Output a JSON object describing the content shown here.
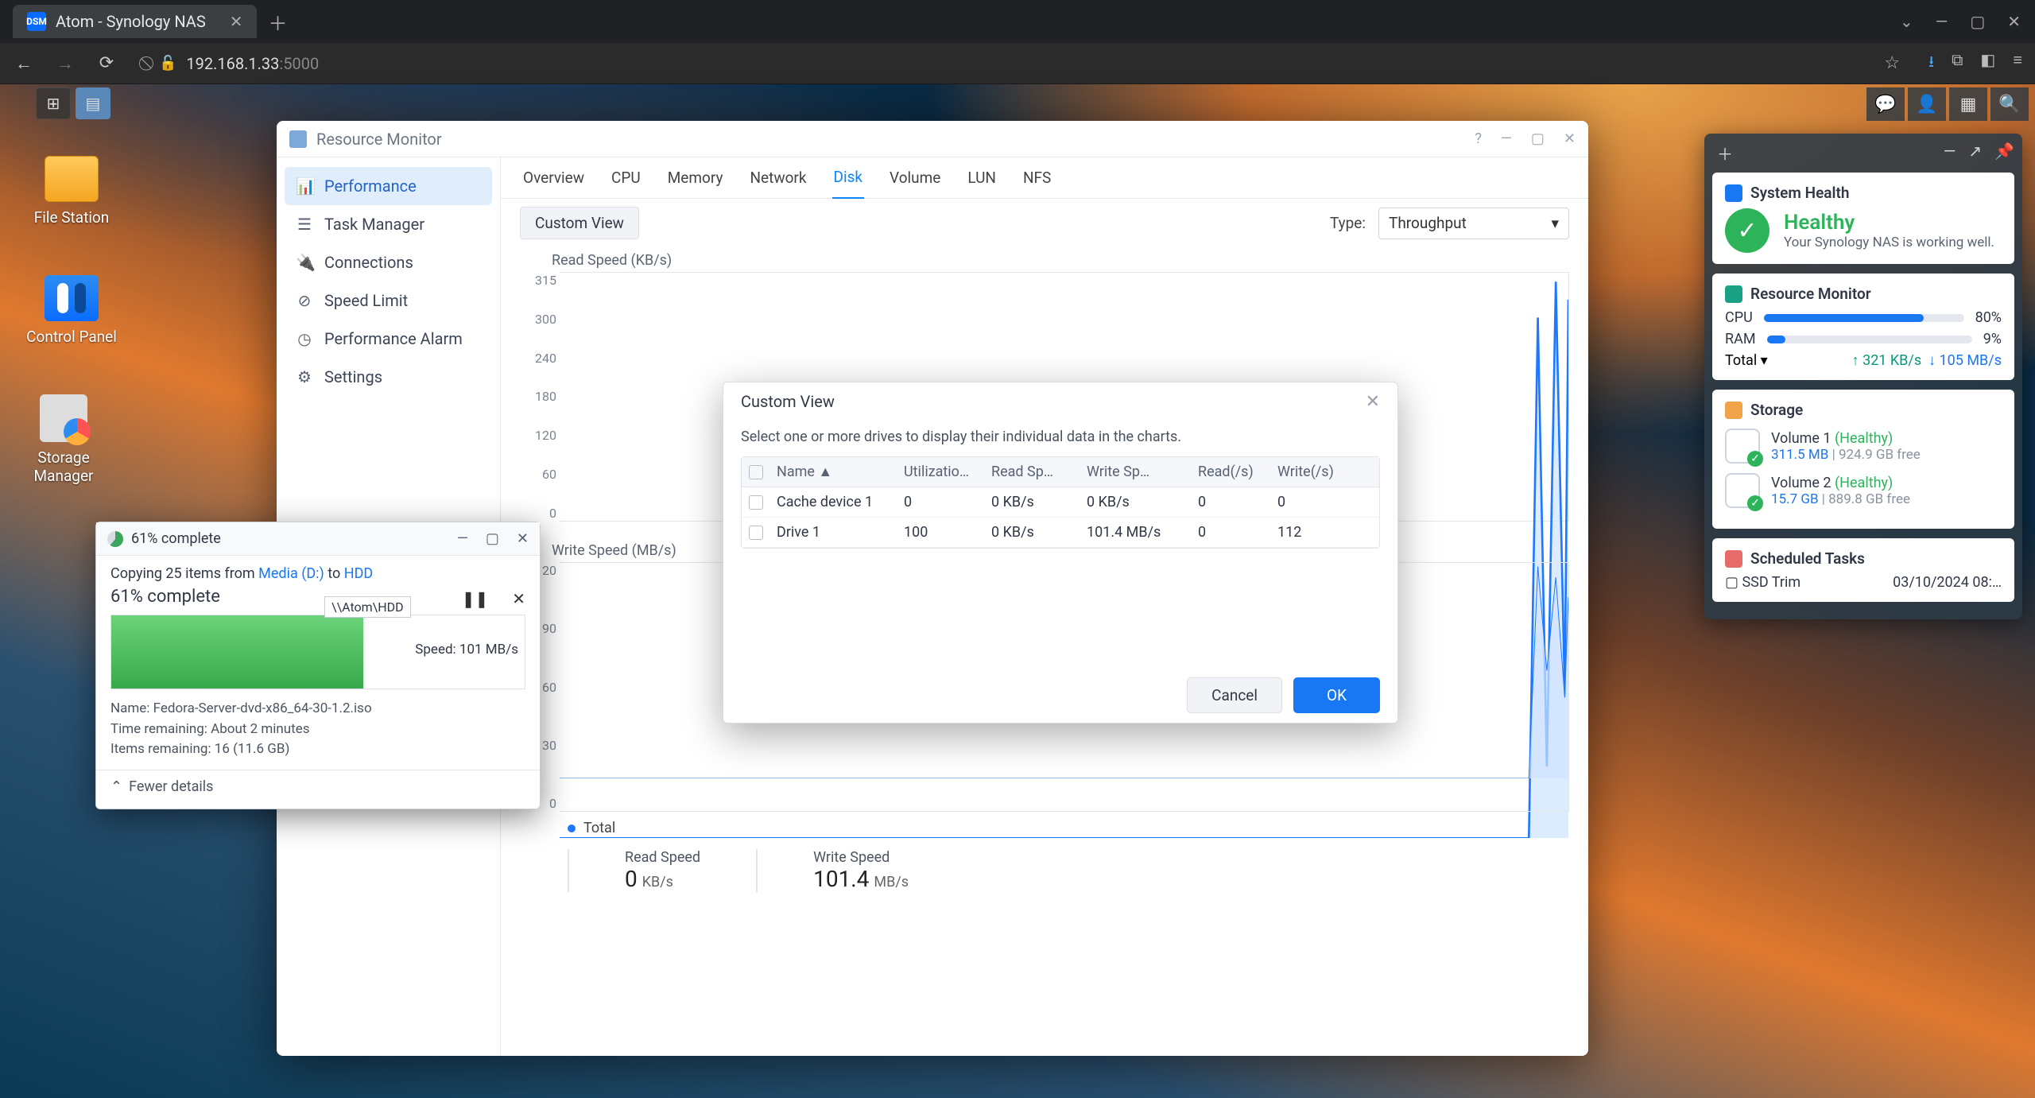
{
  "browser": {
    "tab_title": "Atom - Synology NAS",
    "url_host": "192.168.1.33",
    "url_port": ":5000"
  },
  "desktop_icons": [
    {
      "label": "File Station"
    },
    {
      "label": "Control Panel"
    },
    {
      "label": "Storage Manager"
    }
  ],
  "rm": {
    "title": "Resource Monitor",
    "sidebar": [
      "Performance",
      "Task Manager",
      "Connections",
      "Speed Limit",
      "Performance Alarm",
      "Settings"
    ],
    "tabs": [
      "Overview",
      "CPU",
      "Memory",
      "Network",
      "Disk",
      "Volume",
      "LUN",
      "NFS"
    ],
    "active_tab": "Disk",
    "custom_view_btn": "Custom View",
    "type_label": "Type:",
    "type_value": "Throughput",
    "legend_total": "Total",
    "stats": {
      "read_label": "Read Speed",
      "read_val": "0",
      "read_unit": "KB/s",
      "write_label": "Write Speed",
      "write_val": "101.4",
      "write_unit": "MB/s"
    }
  },
  "chart_data": [
    {
      "type": "line",
      "title": "Read Speed (KB/s)",
      "ylabel": "KB/s",
      "ylim": [
        0,
        315
      ],
      "yticks": [
        315,
        300,
        240,
        180,
        120,
        60,
        0
      ],
      "x": [
        0,
        50,
        100,
        150,
        200,
        250,
        300,
        350,
        400,
        450,
        500,
        540,
        545,
        550,
        555,
        560,
        562
      ],
      "series": [
        {
          "name": "Total",
          "values": [
            0,
            0,
            0,
            0,
            0,
            0,
            0,
            0,
            0,
            0,
            0,
            0,
            290,
            40,
            310,
            80,
            300
          ]
        }
      ]
    },
    {
      "type": "line",
      "title": "Write Speed (MB/s)",
      "ylabel": "MB/s",
      "ylim": [
        0,
        120
      ],
      "yticks": [
        120,
        90,
        60,
        30,
        0
      ],
      "x": [
        0,
        50,
        100,
        150,
        200,
        250,
        300,
        350,
        400,
        450,
        500,
        540,
        545,
        550,
        555,
        560,
        562
      ],
      "series": [
        {
          "name": "Total",
          "values": [
            0,
            0,
            0,
            0,
            0,
            0,
            0,
            0,
            0,
            0,
            0,
            0,
            118,
            60,
            112,
            45,
            101
          ]
        }
      ]
    }
  ],
  "modal": {
    "title": "Custom View",
    "hint": "Select one or more drives to display their individual data in the charts.",
    "columns": [
      "Name ▲",
      "Utilizatio…",
      "Read Sp…",
      "Write Sp…",
      "Read(/s)",
      "Write(/s)"
    ],
    "rows": [
      {
        "name": "Cache device 1",
        "util": "0",
        "read": "0 KB/s",
        "write": "0 KB/s",
        "rps": "0",
        "wps": "0"
      },
      {
        "name": "Drive 1",
        "util": "100",
        "read": "0 KB/s",
        "write": "101.4 MB/s",
        "rps": "0",
        "wps": "112"
      }
    ],
    "cancel": "Cancel",
    "ok": "OK"
  },
  "filecopy": {
    "title": "61% complete",
    "line1_a": "Copying 25 items from ",
    "line1_src": "Media (D:)",
    "line1_to": " to ",
    "line1_dst": "HDD",
    "headline": "61% complete",
    "tip": "\\\\Atom\\HDD",
    "speed": "Speed: 101 MB/s",
    "meta1": "Name: Fedora-Server-dvd-x86_64-30-1.2.iso",
    "meta2": "Time remaining: About 2 minutes",
    "meta3": "Items remaining: 16 (11.6 GB)",
    "fewer": "Fewer details"
  },
  "widgets": {
    "sh_title": "System Health",
    "sh_status": "Healthy",
    "sh_sub": "Your Synology NAS is working well.",
    "rm_title": "Resource Monitor",
    "cpu_label": "CPU",
    "cpu_pct": "80%",
    "cpu_val": 80,
    "ram_label": "RAM",
    "ram_pct": "9%",
    "ram_val": 9,
    "total_label": "Total ▾",
    "up": "↑ 321 KB/s",
    "dn": "↓ 105 MB/s",
    "st_title": "Storage",
    "vol1_name": "Volume 1 ",
    "vol1_status": "(Healthy)",
    "vol1_used": "311.5 MB",
    "vol1_free": " | 924.9 GB free",
    "vol2_name": "Volume 2 ",
    "vol2_status": "(Healthy)",
    "vol2_used": "15.7 GB",
    "vol2_free": " | 889.8 GB free",
    "tk_title": "Scheduled Tasks",
    "tk_name": "SSD Trim",
    "tk_time": "03/10/2024 08:…"
  }
}
